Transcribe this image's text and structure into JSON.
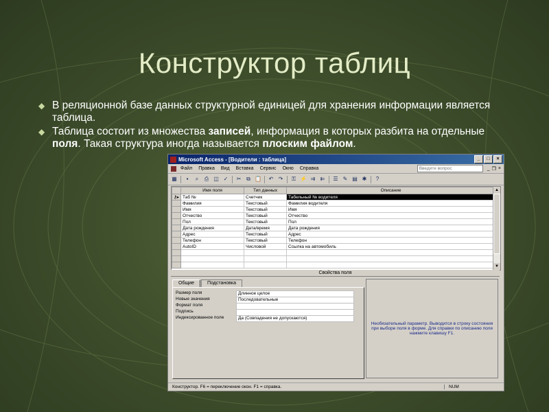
{
  "slide": {
    "title": "Конструктор таблиц",
    "bullet1": "В реляционной базе данных структурной единицей для хранения информации является таблица.",
    "bullet2_a": "Таблица состоит из множества ",
    "bullet2_b": "записей",
    "bullet2_c": ", информация в которых разбита на отдельные ",
    "bullet2_d": "поля",
    "bullet2_e": ". Такая структура иногда называется ",
    "bullet2_f": "плоским файлом",
    "bullet2_g": "."
  },
  "window": {
    "title": "Microsoft Access - [Водители : таблица]",
    "menu": [
      "Файл",
      "Правка",
      "Вид",
      "Вставка",
      "Сервис",
      "Окно",
      "Справка"
    ],
    "help_placeholder": "Введите вопрос"
  },
  "grid": {
    "headers": [
      "Имя поля",
      "Тип данных",
      "Описание"
    ],
    "rows": [
      {
        "name": "Таб №",
        "type": "Счетчик",
        "desc": "Табельный № водителя"
      },
      {
        "name": "Фамилия",
        "type": "Текстовый",
        "desc": "Фамилия водителя"
      },
      {
        "name": "Имя",
        "type": "Текстовый",
        "desc": "Имя"
      },
      {
        "name": "Отчество",
        "type": "Текстовый",
        "desc": "Отчество"
      },
      {
        "name": "Пол",
        "type": "Текстовый",
        "desc": "Пол"
      },
      {
        "name": "Дата рождения",
        "type": "Дата/время",
        "desc": "Дата рождения"
      },
      {
        "name": "Адрес",
        "type": "Текстовый",
        "desc": "Адрес"
      },
      {
        "name": "Телефон",
        "type": "Текстовый",
        "desc": "Телефон"
      },
      {
        "name": "AutoID",
        "type": "Числовой",
        "desc": "Ссылка на автомобиль"
      },
      {
        "name": "",
        "type": "",
        "desc": ""
      },
      {
        "name": "",
        "type": "",
        "desc": ""
      },
      {
        "name": "",
        "type": "",
        "desc": ""
      }
    ]
  },
  "props": {
    "header": "Свойства поля",
    "tab_general": "Общие",
    "tab_lookup": "Подстановка",
    "rows": [
      {
        "name": "Размер поля",
        "value": "Длинное целое"
      },
      {
        "name": "Новые значения",
        "value": "Последовательные"
      },
      {
        "name": "Формат поля",
        "value": ""
      },
      {
        "name": "Подпись",
        "value": ""
      },
      {
        "name": "Индексированное поле",
        "value": "Да (Совпадения не допускаются)"
      }
    ],
    "help_text": "Необязательный параметр. Выводится в строку состояния при выборе поля в форме. Для справки по описанию поля нажмите клавишу F1."
  },
  "status": {
    "text": "Конструктор. F6 = переключение окон. F1 = справка.",
    "num": "NUM"
  }
}
